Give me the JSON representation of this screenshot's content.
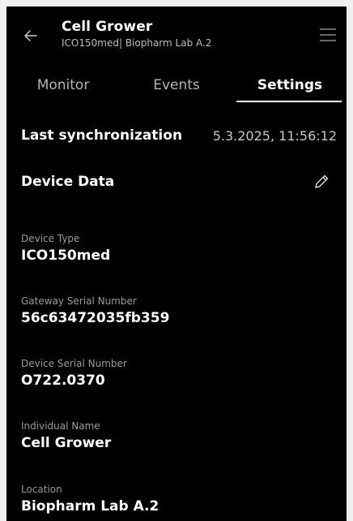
{
  "header": {
    "title": "Cell Grower",
    "subtitle": "ICO150med| Biopharm Lab A.2",
    "back_icon": "arrow-left-icon",
    "menu_icon": "hamburger-menu-icon"
  },
  "tabs": [
    {
      "label": "Monitor",
      "active": false
    },
    {
      "label": "Events",
      "active": false
    },
    {
      "label": "Settings",
      "active": true
    }
  ],
  "sync": {
    "label": "Last synchronization",
    "value": "5.3.2025, 11:56:12"
  },
  "device_data": {
    "title": "Device Data",
    "edit_icon": "pencil-icon",
    "fields": [
      {
        "label": "Device Type",
        "value": "ICO150med"
      },
      {
        "label": "Gateway Serial Number",
        "value": "56c63472035fb359"
      },
      {
        "label": "Device Serial Number",
        "value": "O722.0370"
      },
      {
        "label": "Individual Name",
        "value": "Cell Grower"
      },
      {
        "label": "Location",
        "value": "Biopharm Lab A.2"
      }
    ]
  },
  "colors": {
    "background": "#000000",
    "text": "#ffffff",
    "muted": "#9a9a9a"
  }
}
